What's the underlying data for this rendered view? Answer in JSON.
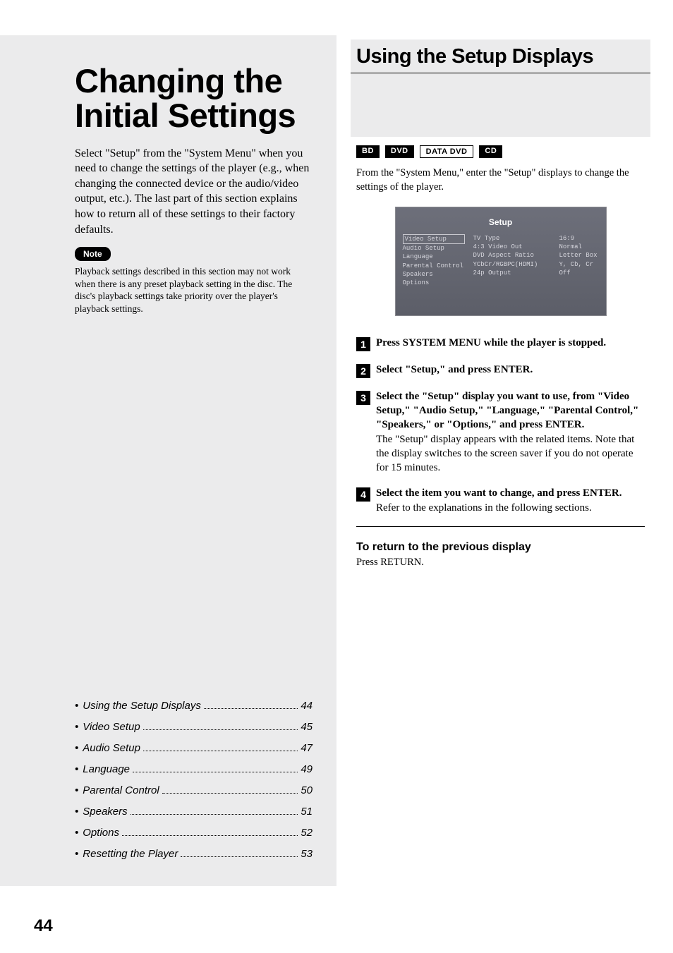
{
  "left": {
    "chapter_title": "Changing the Initial Settings",
    "intro": "Select \"Setup\" from the \"System Menu\" when you need to change the settings of the player (e.g., when changing the connected device or the audio/video output, etc.). The last part of this section explains how to return all of these settings to their factory defaults.",
    "note_label": "Note",
    "note_text": "Playback settings described in this section may not work when there is any preset playback setting in the disc. The disc's playback settings take priority over the player's playback settings.",
    "toc": [
      {
        "label": "Using the Setup Displays",
        "page": "44"
      },
      {
        "label": "Video Setup",
        "page": "45"
      },
      {
        "label": "Audio Setup",
        "page": "47"
      },
      {
        "label": "Language",
        "page": "49"
      },
      {
        "label": "Parental Control",
        "page": "50"
      },
      {
        "label": "Speakers",
        "page": "51"
      },
      {
        "label": "Options",
        "page": "52"
      },
      {
        "label": "Resetting the Player",
        "page": "53"
      }
    ],
    "page_number": "44"
  },
  "right": {
    "section_title": "Using the Setup Displays",
    "badges": [
      "BD",
      "DVD",
      "DATA DVD",
      "CD"
    ],
    "after_badges": "From the \"System Menu,\" enter the \"Setup\" displays to change the settings of the player.",
    "setup_mock": {
      "title": "Setup",
      "colA": [
        "Video Setup",
        "Audio Setup",
        "Language",
        "Parental Control",
        "Speakers",
        "Options"
      ],
      "colB": [
        "TV Type",
        "4:3 Video Out",
        "DVD Aspect Ratio",
        "YCbCr/RGBPC(HDMI)",
        "24p Output"
      ],
      "colC": [
        "16:9",
        "Normal",
        "Letter Box",
        "Y, Cb, Cr",
        "Off"
      ]
    },
    "steps": [
      {
        "n": "1",
        "bold": "Press SYSTEM MENU while the player is stopped.",
        "plain": ""
      },
      {
        "n": "2",
        "bold": "Select \"Setup,\" and press ENTER.",
        "plain": ""
      },
      {
        "n": "3",
        "bold": "Select the \"Setup\" display you want to use, from \"Video Setup,\" \"Audio Setup,\" \"Language,\" \"Parental Control,\" \"Speakers,\" or \"Options,\" and press ENTER.",
        "plain": "The \"Setup\" display appears with the related items. Note that the display switches to the screen saver if you do not operate for 15 minutes."
      },
      {
        "n": "4",
        "bold": "Select the item you want to change, and press ENTER.",
        "plain": "Refer to the explanations in the following sections."
      }
    ],
    "return_head": "To return to the previous display",
    "return_body": "Press RETURN."
  }
}
